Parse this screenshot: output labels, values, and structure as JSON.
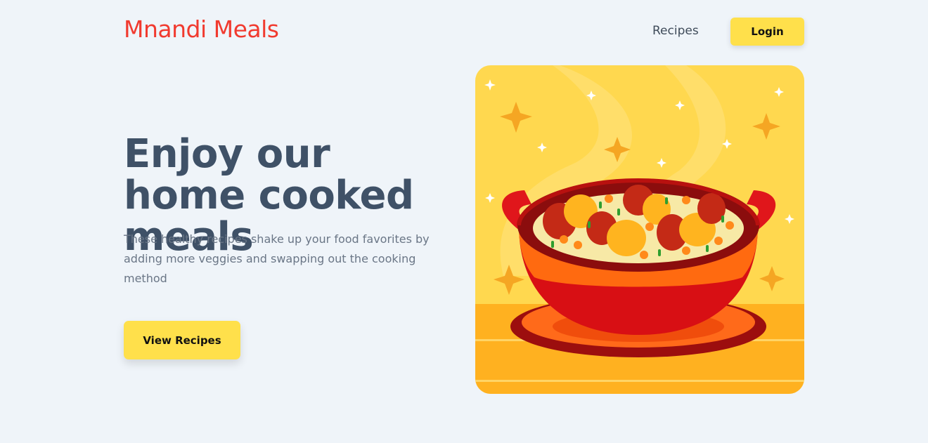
{
  "header": {
    "brand": "Mnandi Meals",
    "nav": {
      "recipes_label": "Recipes",
      "login_label": "Login"
    }
  },
  "hero": {
    "title": "Enjoy our home cooked meals",
    "description": "These healthy recipes shake up your food favorites by adding more veggies and swapping out the cooking method",
    "cta_label": "View Recipes",
    "image_icon": "cooking-pot-illustration"
  },
  "colors": {
    "brand": "#f13a2f",
    "accent": "#ffe04b",
    "background": "#eff4f9",
    "heading": "#3f5167",
    "body_text": "#6a7686"
  }
}
